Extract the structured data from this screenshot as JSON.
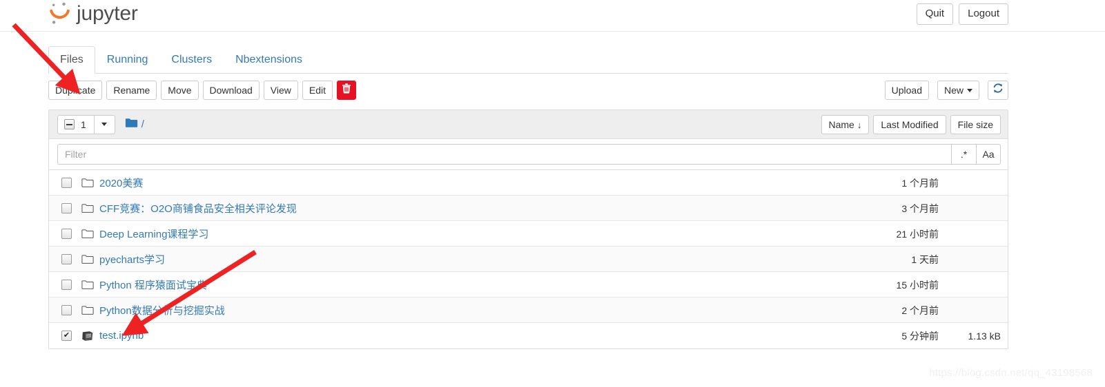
{
  "header": {
    "brand_text": "jupyter",
    "brand_logo_icon": "jupyter-logo-icon",
    "quit_label": "Quit",
    "logout_label": "Logout"
  },
  "tabs": [
    {
      "label": "Files",
      "active": true
    },
    {
      "label": "Running",
      "active": false
    },
    {
      "label": "Clusters",
      "active": false
    },
    {
      "label": "Nbextensions",
      "active": false
    }
  ],
  "toolbar": {
    "duplicate_label": "Duplicate",
    "rename_label": "Rename",
    "move_label": "Move",
    "download_label": "Download",
    "view_label": "View",
    "edit_label": "Edit",
    "delete_icon": "trash-icon",
    "delete_color": "#e81123",
    "upload_label": "Upload",
    "new_label": "New",
    "refresh_icon": "refresh-icon"
  },
  "list_header": {
    "selected_count": "1",
    "select_checkbox_state": "indeterminate",
    "select_dropdown_icon": "chevron-down-icon",
    "folder_icon": "folder-icon",
    "breadcrumb_root": "/",
    "sort_name_label": "Name",
    "sort_name_arrow": "↓",
    "sort_modified_label": "Last Modified",
    "sort_size_label": "File size"
  },
  "filter": {
    "placeholder": "Filter",
    "value": "",
    "regex_label": ".*",
    "case_label": "Aa"
  },
  "files": [
    {
      "name": "2020美赛",
      "type": "folder",
      "icon": "folder-outline-icon",
      "modified": "1 个月前",
      "size": "",
      "checked": false
    },
    {
      "name": "CFF竞赛：O2O商铺食品安全相关评论发现",
      "type": "folder",
      "icon": "folder-outline-icon",
      "modified": "3 个月前",
      "size": "",
      "checked": false
    },
    {
      "name": "Deep Learning课程学习",
      "type": "folder",
      "icon": "folder-outline-icon",
      "modified": "21 小时前",
      "size": "",
      "checked": false
    },
    {
      "name": "pyecharts学习",
      "type": "folder",
      "icon": "folder-outline-icon",
      "modified": "1 天前",
      "size": "",
      "checked": false
    },
    {
      "name": "Python 程序猿面试宝典",
      "type": "folder",
      "icon": "folder-outline-icon",
      "modified": "15 小时前",
      "size": "",
      "checked": false
    },
    {
      "name": "Python数据分析与挖掘实战",
      "type": "folder",
      "icon": "folder-outline-icon",
      "modified": "2 个月前",
      "size": "",
      "checked": false
    },
    {
      "name": "test.ipynb",
      "type": "notebook",
      "icon": "notebook-icon",
      "modified": "5 分钟前",
      "size": "1.13 kB",
      "checked": true
    }
  ],
  "watermark": {
    "text": "https://blog.csdn.net/qq_43198568"
  },
  "annotations": {
    "arrow_color": "#ee2222",
    "arrow_1_target": "duplicate-button",
    "arrow_2_target": "test-ipynb-row"
  },
  "colors": {
    "link": "#337ab7",
    "brand_orange": "#f37726",
    "danger": "#e81123"
  }
}
